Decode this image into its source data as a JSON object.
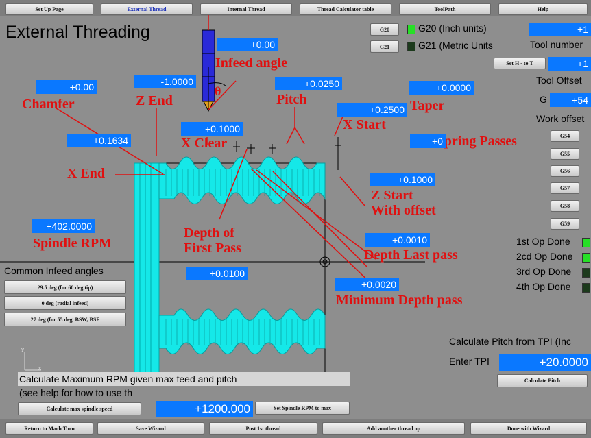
{
  "top_tabs": [
    "Set Up Page",
    "External Thread",
    "Internal Thread",
    "Thread Calculator table",
    "ToolPath",
    "Help"
  ],
  "title": "External Threading",
  "units": {
    "g20_button": "G20",
    "g20_label": "G20 (Inch units)",
    "g21_button": "G21",
    "g21_label": "G21 (Metric Units"
  },
  "tool": {
    "number_value": "+1",
    "number_label": "Tool number",
    "set_h_button": "Set H - to T",
    "h_value": "+1",
    "offset_label": "Tool Offset",
    "g_label": "G",
    "g_value": "+54",
    "work_offset_label": "Work offset"
  },
  "work_offsets": [
    "G54",
    "G55",
    "G56",
    "G57",
    "G58",
    "G59"
  ],
  "fields": {
    "infeed_angle": "+0.00",
    "chamfer": "+0.00",
    "z_end": "-1.0000",
    "pitch": "+0.0250",
    "taper": "+0.0000",
    "x_start": "+0.2500",
    "x_clear": "+0.1000",
    "spring_passes": "+0",
    "x_end": "+0.1634",
    "z_start_offset": "+0.1000",
    "spindle_rpm": "+402.0000",
    "depth_last_pass": "+0.0010",
    "depth_first_pass": "+0.0100",
    "min_depth_pass": "+0.0020"
  },
  "labels": {
    "infeed_angle": "Infeed angle",
    "chamfer": "Chamfer",
    "z_end": "Z End",
    "pitch": "Pitch",
    "taper": "Taper",
    "x_start": "X Start",
    "x_clear": "X Clear",
    "spring_passes": "# of Spring Passes",
    "x_end": "X End",
    "z_start_1": "Z Start",
    "z_start_2": "With offset",
    "spindle_rpm": "Spindle RPM",
    "depth_first_1": "Depth of",
    "depth_first_2": "First Pass",
    "depth_last": "Depth Last pass",
    "min_depth": "Minimum Depth pass",
    "theta": "θ"
  },
  "op_done": [
    {
      "label": "1st Op Done",
      "state": "on"
    },
    {
      "label": "2cd Op Done",
      "state": "on"
    },
    {
      "label": "3rd Op Done",
      "state": "off"
    },
    {
      "label": "4th Op Done",
      "state": "off"
    }
  ],
  "infeed": {
    "header": "Common Infeed angles",
    "buttons": [
      "29.5 deg (for 60 deg tip)",
      "0 deg (radial infeed)",
      "27 deg (for 55 deg, BSW, BSF"
    ]
  },
  "tpi": {
    "header": "Calculate Pitch from TPI (Inc",
    "enter_label": "Enter TPI",
    "value": "+20.0000",
    "calc_button": "Calculate Pitch"
  },
  "max_rpm": {
    "line1": "Calculate Maximum RPM given max feed and pitch",
    "line2": "(see help for how to use th",
    "calc_button": "Calculate max spindle speed",
    "value": "+1200.000",
    "set_button": "Set Spindle RPM to max"
  },
  "bottom_buttons": [
    "Return to Mach Turn",
    "Save Wizard",
    "Post 1st thread",
    "Add another thread op",
    "Done with Wizard"
  ],
  "axis_labels": {
    "y": "y",
    "x": "x"
  },
  "colors": {
    "dro_blue": "#0a78ff",
    "thread_cyan": "#15e8e8",
    "annotation_red": "#e01010",
    "led_on": "#27e027"
  }
}
